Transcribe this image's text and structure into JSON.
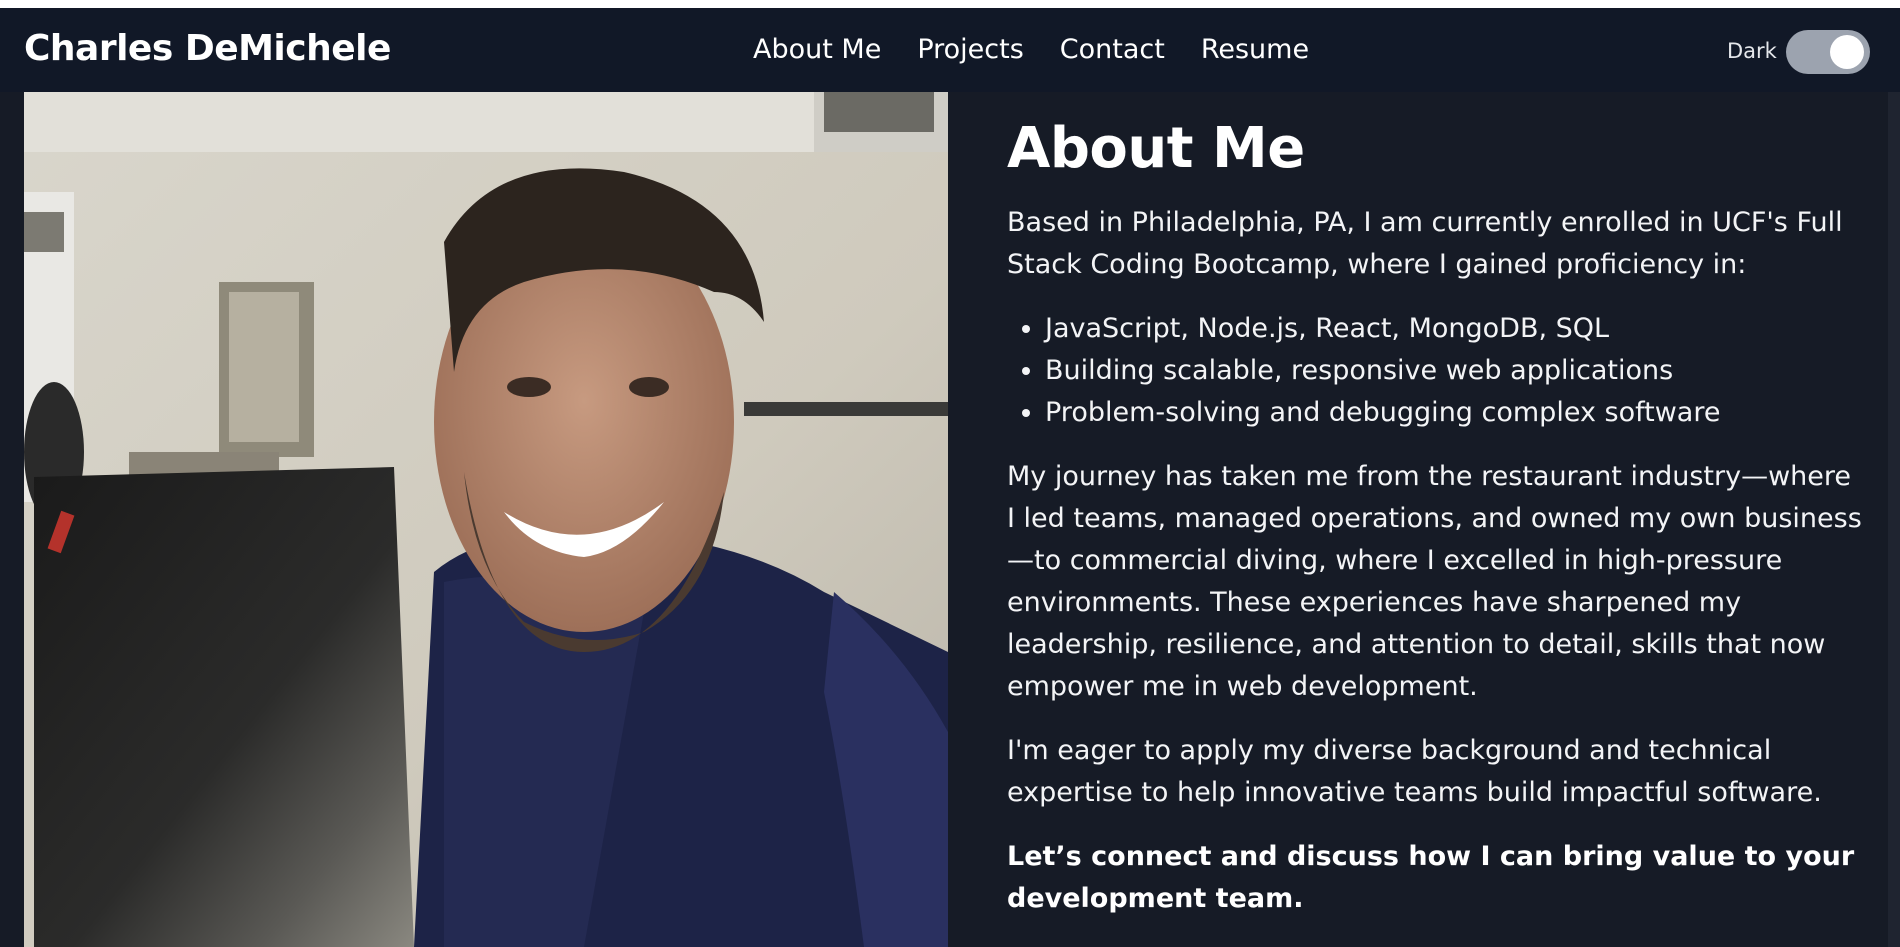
{
  "header": {
    "brand": "Charles DeMichele",
    "nav": [
      {
        "label": "About Me"
      },
      {
        "label": "Projects"
      },
      {
        "label": "Contact"
      },
      {
        "label": "Resume"
      }
    ],
    "theme_label": "Dark",
    "theme_toggle_on": true
  },
  "about": {
    "heading": "About Me",
    "intro": "Based in Philadelphia, PA, I am currently enrolled in UCF's Full Stack Coding Bootcamp, where I gained proficiency in:",
    "skills": [
      "JavaScript, Node.js, React, MongoDB, SQL",
      "Building scalable, responsive web applications",
      "Problem-solving and debugging complex software"
    ],
    "journey": "My journey has taken me from the restaurant industry—where I led teams, managed operations, and owned my own business—to commercial diving, where I excelled in high-pressure environments. These experiences have sharpened my leadership, resilience, and attention to detail, skills that now empower me in web development.",
    "eager": "I'm eager to apply my diverse background and technical expertise to help innovative teams build impactful software.",
    "cta": "Let’s connect and discuss how I can bring value to your development team."
  },
  "colors": {
    "page_bg": "#161b26",
    "navbar_bg": "#111827",
    "toggle_track": "#9ca3af",
    "text": "#ffffff"
  }
}
